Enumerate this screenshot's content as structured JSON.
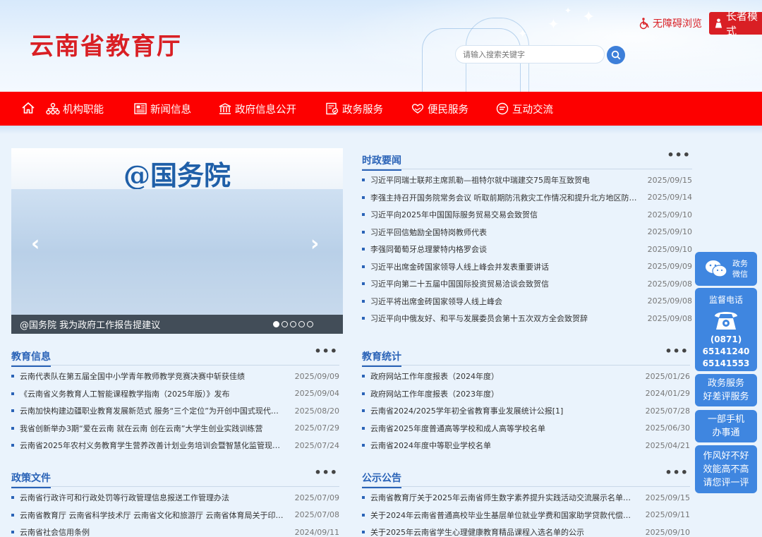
{
  "header": {
    "site_title": "云南省教育厅",
    "search_placeholder": "请输入搜索关键字",
    "accessibility_label": "无障碍浏览",
    "elder_mode_label": "长者模式"
  },
  "nav": {
    "items": [
      {
        "label": "机构职能",
        "icon": "org-chart-icon"
      },
      {
        "label": "新闻信息",
        "icon": "newspaper-icon"
      },
      {
        "label": "政府信息公开",
        "icon": "government-building-icon"
      },
      {
        "label": "政务服务",
        "icon": "document-check-icon"
      },
      {
        "label": "便民服务",
        "icon": "heart-hand-icon"
      },
      {
        "label": "互动交流",
        "icon": "chat-icon"
      }
    ]
  },
  "carousel": {
    "headline": "@国务院",
    "caption": "@国务院 我为政府工作报告提建议",
    "slide_count": 5,
    "active_slide": 1
  },
  "news": {
    "title": "时政要闻",
    "more": "•••",
    "items": [
      {
        "title": "习近平同瑞士联邦主席凯勒—祖特尔就中瑞建交75周年互致贺电",
        "date": "2025/09/15"
      },
      {
        "title": "李强主持召开国务院常务会议 听取前期防汛救灾工作情况和提升北方地区防…",
        "date": "2025/09/14"
      },
      {
        "title": "习近平向2025年中国国际服务贸易交易会致贺信",
        "date": "2025/09/10"
      },
      {
        "title": "习近平回信勉励全国特岗教师代表",
        "date": "2025/09/10"
      },
      {
        "title": "李强同葡萄牙总理蒙特内格罗会谈",
        "date": "2025/09/10"
      },
      {
        "title": "习近平出席金砖国家领导人线上峰会并发表重要讲话",
        "date": "2025/09/09"
      },
      {
        "title": "习近平向第二十五届中国国际投资贸易洽谈会致贺信",
        "date": "2025/09/08"
      },
      {
        "title": "习近平将出席金砖国家领导人线上峰会",
        "date": "2025/09/08"
      },
      {
        "title": "习近平向中俄友好、和平与发展委员会第十五次双方全会致贺辞",
        "date": "2025/09/08"
      }
    ]
  },
  "edu_info": {
    "title": "教育信息",
    "more": "•••",
    "items": [
      {
        "title": "云南代表队在第五届全国中小学青年教师教学竞赛决赛中斩获佳绩",
        "date": "2025/09/09"
      },
      {
        "title": "《云南省义务教育人工智能课程教学指南（2025年版）》发布",
        "date": "2025/09/04"
      },
      {
        "title": "云南加快构建边疆职业教育发展新范式 服务“三个定位”为开创中国式现代…",
        "date": "2025/08/20"
      },
      {
        "title": "我省创新举办3期“爱在云南 就在云南 创在云南”大学生创业实践训练营",
        "date": "2025/07/29"
      },
      {
        "title": "云南省2025年农村义务教育学生营养改善计划业务培训会暨智慧化监管现…",
        "date": "2025/07/24"
      }
    ]
  },
  "edu_stats": {
    "title": "教育统计",
    "more": "•••",
    "items": [
      {
        "title": "政府网站工作年度报表（2024年度）",
        "date": "2025/01/26"
      },
      {
        "title": "政府网站工作年度报表（2023年度）",
        "date": "2024/01/29"
      },
      {
        "title": "云南省2024/2025学年初全省教育事业发展统计公报[1]",
        "date": "2025/07/28"
      },
      {
        "title": "云南省2025年度普通高等学校和成人高等学校名单",
        "date": "2025/06/30"
      },
      {
        "title": "云南省2024年度中等职业学校名单",
        "date": "2025/04/21"
      }
    ]
  },
  "policy": {
    "title": "政策文件",
    "more": "•••",
    "items": [
      {
        "title": "云南省行政许可和行政处罚等行政管理信息报送工作管理办法",
        "date": "2025/07/09"
      },
      {
        "title": "云南省教育厅 云南省科学技术厅 云南省文化和旅游厅 云南省体育局关于印…",
        "date": "2025/07/08"
      },
      {
        "title": "云南省社会信用条例",
        "date": "2024/09/11"
      }
    ]
  },
  "notices": {
    "title": "公示公告",
    "more": "•••",
    "items": [
      {
        "title": "云南省教育厅关于2025年云南省师生数字素养提升实践活动交流展示名单…",
        "date": "2025/09/15"
      },
      {
        "title": "关于2024年云南省普通高校毕业生基层单位就业学费和国家助学贷款代偿…",
        "date": "2025/09/11"
      },
      {
        "title": "关于2025年云南省学生心理健康教育精品课程入选名单的公示",
        "date": "2025/09/10"
      }
    ]
  },
  "sidebar": {
    "wechat": {
      "line1": "政务",
      "line2": "微信"
    },
    "hotline": {
      "title": "监督电话",
      "area": "(0871)",
      "num1": "65141240",
      "num2": "65141553"
    },
    "review": {
      "line1": "政务服务",
      "line2": "好差评服务"
    },
    "mobile": {
      "line1": "一部手机",
      "line2": "办事通"
    },
    "feedback": {
      "line1": "作风好不好",
      "line2": "效能高不高",
      "line3": "请您评一评"
    }
  },
  "colors": {
    "brand_red": "#d91f24",
    "nav_red": "#fd0000",
    "accent_blue": "#2a63b7",
    "side_blue": "#3f86e0"
  }
}
